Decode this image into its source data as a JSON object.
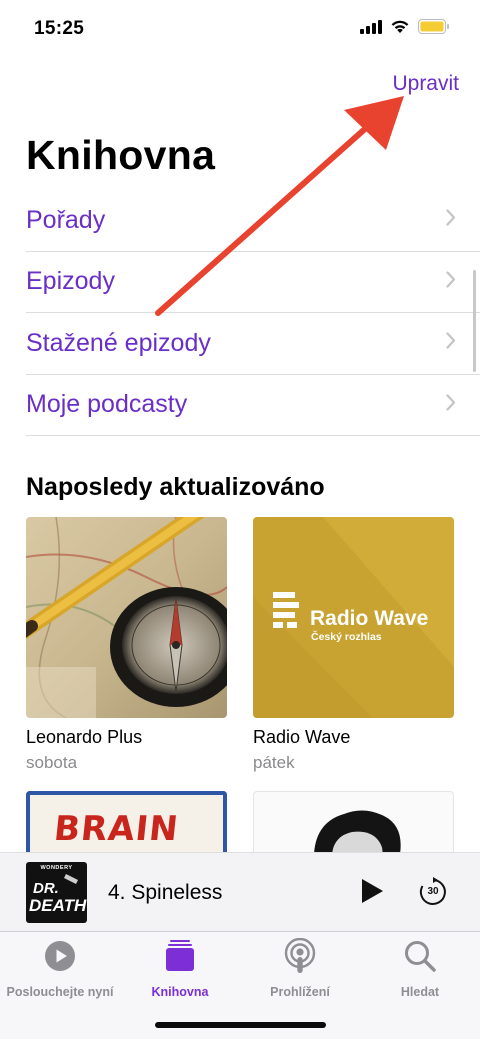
{
  "status_bar": {
    "time": "15:25",
    "icons": [
      "cellular-icon",
      "wifi-icon",
      "battery-icon"
    ],
    "battery_color": "#f5cc34"
  },
  "header": {
    "edit_label": "Upravit",
    "title": "Knihovna"
  },
  "menu": {
    "items": [
      {
        "label": "Pořady"
      },
      {
        "label": "Epizody"
      },
      {
        "label": "Stažené epizody"
      },
      {
        "label": "Moje podcasty"
      }
    ]
  },
  "recent": {
    "title": "Naposledy aktualizováno",
    "tiles": [
      {
        "name": "Leonardo Plus",
        "sub": "sobota"
      },
      {
        "name": "Radio Wave",
        "sub": "pátek",
        "brand_title": "Radio Wave",
        "brand_sub": "Český rozhlas"
      },
      {
        "art_text": "BRAIN WE"
      },
      {
        "name": "",
        "sub": ""
      }
    ]
  },
  "mini_player": {
    "title": "4. Spineless",
    "art_brand": "WONDERY",
    "art_line1": "DR.",
    "art_line2": "DEATH",
    "skip_seconds": "30"
  },
  "tab_bar": {
    "tabs": [
      {
        "label": "Poslouchejte nyní",
        "icon": "play-circle-icon"
      },
      {
        "label": "Knihovna",
        "icon": "library-icon",
        "active": true
      },
      {
        "label": "Prohlížení",
        "icon": "podcast-icon"
      },
      {
        "label": "Hledat",
        "icon": "search-icon"
      }
    ]
  },
  "colors": {
    "accent": "#6a2fc6",
    "annotation_arrow": "#e8432f"
  }
}
